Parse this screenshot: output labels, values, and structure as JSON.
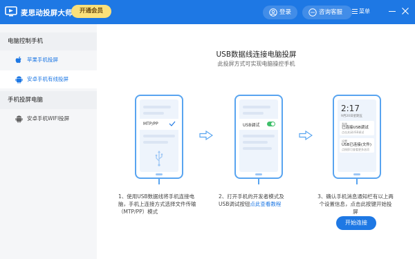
{
  "titlebar": {
    "app_title": "麦思动投屏大师",
    "vip_button": "开通会员",
    "login": "登录",
    "support": "咨询客服",
    "menu": "菜单",
    "brand_color": "#1e78e4",
    "vip_color": "#fbe07a"
  },
  "sidebar": {
    "section_pc": "电脑控制手机",
    "item_apple": "苹果手机投屏",
    "item_android_usb": "安卓手机有线投屏",
    "section_phone": "手机投屏电脑",
    "item_android_wifi": "安卓手机WIFI投屏",
    "icons": [
      "apple-icon",
      "android-icon",
      "android-icon"
    ]
  },
  "main": {
    "title": "USB数据线连接电脑投屏",
    "subtitle": "此投屏方式可实现电脑操控手机",
    "phone1": {
      "option_label": "MTP/PP"
    },
    "phone2": {
      "option_label": "USB调试"
    },
    "phone3": {
      "time": "2:17",
      "date": "9月20日星期五",
      "notifications": [
        {
          "app": "系统",
          "title": "已连接USB调试",
          "sub": "点击关闭USB调试"
        },
        {
          "app": "设置",
          "title": "USB已连接(文件)",
          "sub": "点按即可查看更多选项"
        }
      ]
    },
    "step1": "1、使用USB数据线将手机连接电脑，手机上连接方式选择文件传输（MTP/PP）模式",
    "step2_text": "2、打开手机的开发者模式及USB调试按钮",
    "step2_link": "点此查看教程",
    "step3": "3、确认手机消息通知栏有以上两个设置信息，点击此按键开始投屏",
    "start_button": "开始连接"
  }
}
